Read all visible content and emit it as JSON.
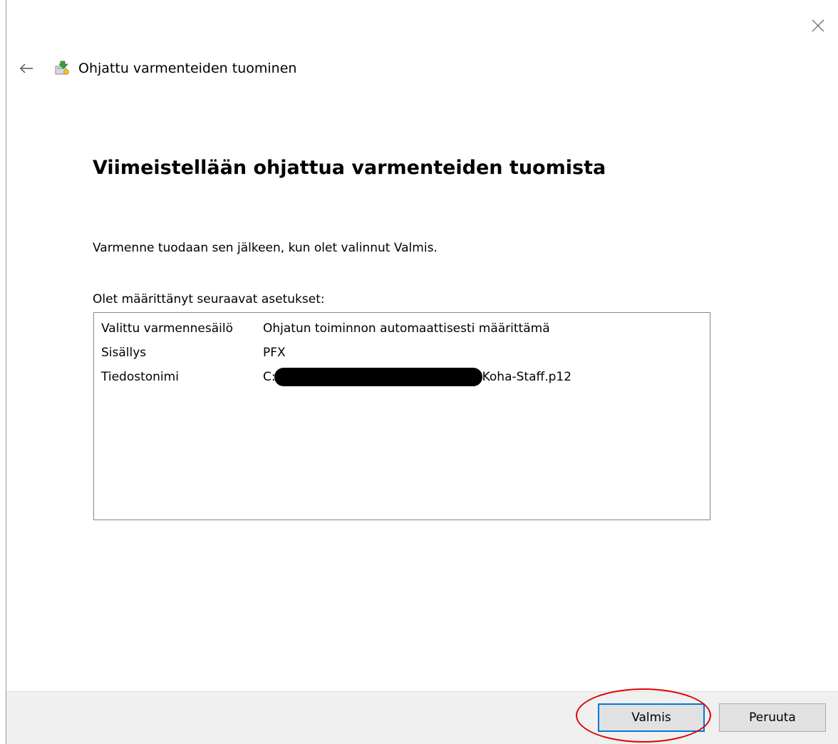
{
  "window": {
    "title": "Ohjattu varmenteiden tuominen"
  },
  "page": {
    "heading": "Viimeistellään ohjattua varmenteiden tuomista",
    "info_text": "Varmenne tuodaan sen jälkeen, kun olet valinnut Valmis.",
    "settings_label": "Olet määrittänyt seuraavat asetukset:"
  },
  "settings": [
    {
      "key": "Valittu varmennesäilö",
      "value": "Ohjatun toiminnon automaattisesti määrittämä"
    },
    {
      "key": "Sisällys",
      "value": "PFX"
    },
    {
      "key": "Tiedostonimi",
      "value_prefix": "C:",
      "value_suffix": "Koha-Staff.p12",
      "redacted": true
    }
  ],
  "buttons": {
    "finish": "Valmis",
    "cancel": "Peruuta"
  },
  "icons": {
    "close": "close-icon",
    "back": "back-arrow-icon",
    "app": "certificate-import-icon"
  },
  "colors": {
    "accent": "#0078d7",
    "highlight": "#e00000",
    "footer_bg": "#f0f0f0"
  }
}
